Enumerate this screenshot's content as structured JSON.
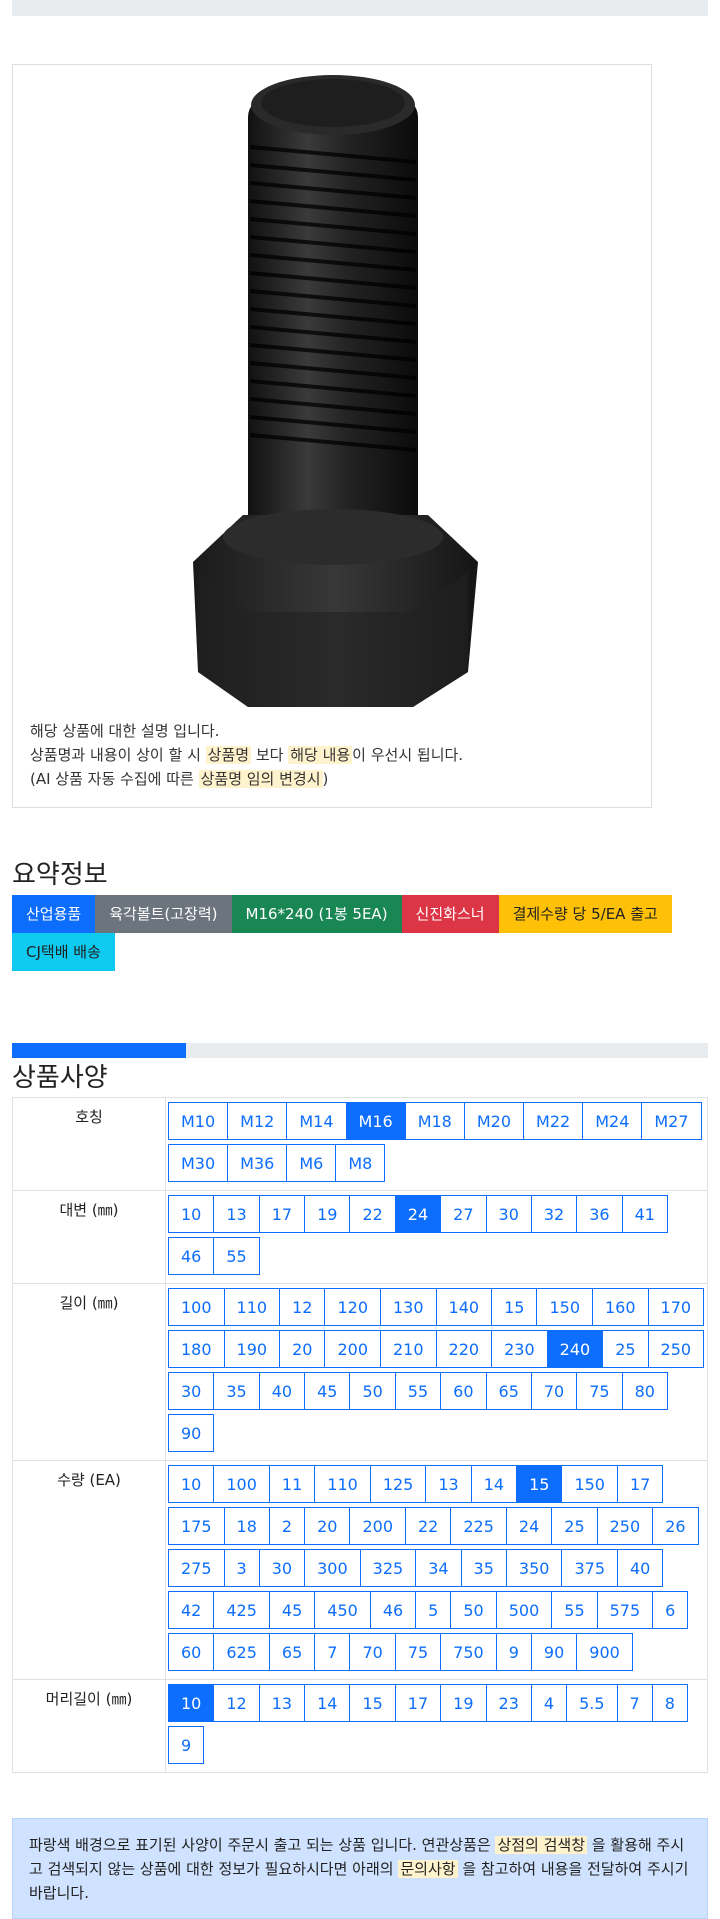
{
  "description": {
    "line1": "해당 상품에 대한 설명 입니다.",
    "line2_a": "상품명과 내용이 상이 할 시 ",
    "line2_hl1": "상품명",
    "line2_b": " 보다 ",
    "line2_hl2": "해당 내용",
    "line2_c": "이 우선시 됩니다.",
    "line3_a": "(AI 상품 자동 수집에 따른 ",
    "line3_hl": "상품명 임의 변경시",
    "line3_b": ")"
  },
  "summary": {
    "title": "요약정보",
    "badges": [
      "산업용품",
      "육각볼트(고장력)",
      "M16*240 (1봉 5EA)",
      "신진화스너",
      "결제수량 당 5/EA 출고",
      "CJ택배 배송"
    ]
  },
  "progress_fraction": 0.25,
  "specs": {
    "title": "상품사양",
    "rows": [
      {
        "label": "호칭",
        "options": [
          "M10",
          "M12",
          "M14",
          "M16",
          "M18",
          "M20",
          "M22",
          "M24",
          "M27",
          "M30",
          "M36",
          "M6",
          "M8"
        ],
        "selected": "M16"
      },
      {
        "label": "대변 (㎜)",
        "options": [
          "10",
          "13",
          "17",
          "19",
          "22",
          "24",
          "27",
          "30",
          "32",
          "36",
          "41",
          "46",
          "55"
        ],
        "selected": "24"
      },
      {
        "label": "길이 (㎜)",
        "options": [
          "100",
          "110",
          "12",
          "120",
          "130",
          "140",
          "15",
          "150",
          "160",
          "170",
          "180",
          "190",
          "20",
          "200",
          "210",
          "220",
          "230",
          "240",
          "25",
          "250",
          "30",
          "35",
          "40",
          "45",
          "50",
          "55",
          "60",
          "65",
          "70",
          "75",
          "80",
          "90"
        ],
        "selected": "240"
      },
      {
        "label": "수량 (EA)",
        "options": [
          "10",
          "100",
          "11",
          "110",
          "125",
          "13",
          "14",
          "15",
          "150",
          "17",
          "175",
          "18",
          "2",
          "20",
          "200",
          "22",
          "225",
          "24",
          "25",
          "250",
          "26",
          "275",
          "3",
          "30",
          "300",
          "325",
          "34",
          "35",
          "350",
          "375",
          "40",
          "42",
          "425",
          "45",
          "450",
          "46",
          "5",
          "50",
          "500",
          "55",
          "575",
          "6",
          "60",
          "625",
          "65",
          "7",
          "70",
          "75",
          "750",
          "9",
          "90",
          "900"
        ],
        "selected": "15"
      },
      {
        "label": "머리길이 (㎜)",
        "options": [
          "10",
          "12",
          "13",
          "14",
          "15",
          "17",
          "19",
          "23",
          "4",
          "5.5",
          "7",
          "8",
          "9"
        ],
        "selected": "10"
      }
    ]
  },
  "notice": {
    "a": "파랑색 배경으로 표기된 사양이 주문시 출고 되는 상품 입니다. 연관상품은 ",
    "hl1": "상점의 검색창",
    "b": " 을 활용해 주시고 검색되지 않는 상품에 대한 정보가 필요하시다면 아래의 ",
    "hl2": "문의사항",
    "c": " 을 참고하여 내용을 전달하여 주시기 바랍니다."
  }
}
